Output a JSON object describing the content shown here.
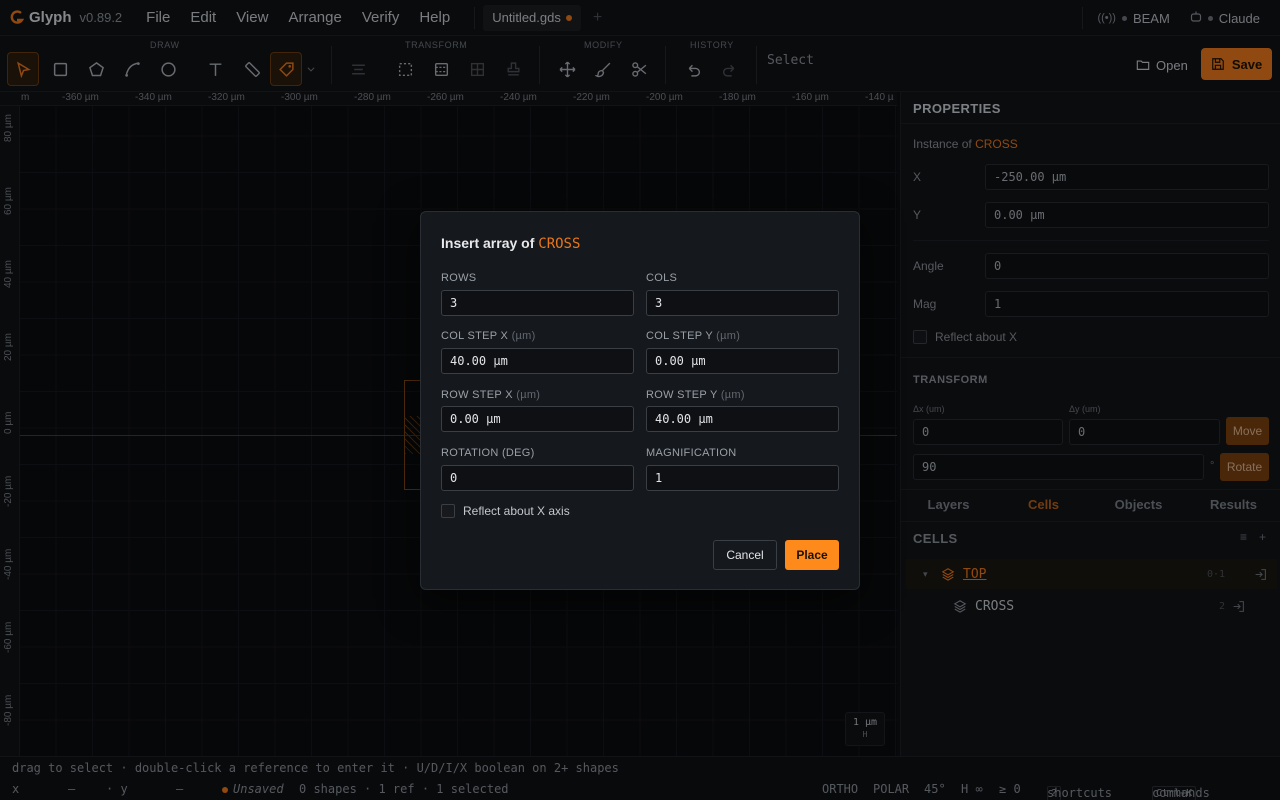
{
  "app": {
    "name": "Glyph",
    "version": "v0.89.2"
  },
  "menu": [
    "File",
    "Edit",
    "View",
    "Arrange",
    "Verify",
    "Help"
  ],
  "document_tab": {
    "label": "Untitled.gds"
  },
  "status_chips": [
    {
      "label": "BEAM",
      "icon": "broadcast-icon"
    },
    {
      "label": "Claude",
      "icon": "robot-icon"
    }
  ],
  "toolbar": {
    "groups": {
      "draw": "DRAW",
      "transform": "TRANSFORM",
      "modify": "MODIFY",
      "history": "HISTORY"
    },
    "mode_label": "Select",
    "open_label": "Open",
    "save_label": "Save"
  },
  "ruler": {
    "top": [
      "m",
      "-360 µm",
      "-340 µm",
      "-320 µm",
      "-300 µm",
      "-280 µm",
      "-260 µm",
      "-240 µm",
      "-220 µm",
      "-200 µm",
      "-180 µm",
      "-160 µm",
      "-140 µ"
    ],
    "left": [
      "80 µm",
      "60 µm",
      "40 µm",
      "20 µm",
      "0 µm",
      "-20 µm",
      "-40 µm",
      "-60 µm",
      "-80 µm"
    ]
  },
  "scale": {
    "value": "1 µm",
    "axis": "H"
  },
  "properties": {
    "title": "PROPERTIES",
    "instance_prefix": "Instance of",
    "instance_cell": "CROSS",
    "x_label": "X",
    "x_value": "-250.00 µm",
    "y_label": "Y",
    "y_value": "0.00 µm",
    "angle_label": "Angle",
    "angle_value": "0",
    "mag_label": "Mag",
    "mag_value": "1",
    "reflect_label": "Reflect about X"
  },
  "transform": {
    "title": "TRANSFORM",
    "dx_label": "Δx (um)",
    "dx_value": "0",
    "dy_label": "Δy (um)",
    "dy_value": "0",
    "move_label": "Move",
    "rotate_value": "90",
    "rotate_unit": "°",
    "rotate_label": "Rotate"
  },
  "panel_tabs": [
    "Layers",
    "Cells",
    "Objects",
    "Results"
  ],
  "cells": {
    "title": "CELLS",
    "items": [
      {
        "name": "TOP",
        "count": "0·1"
      },
      {
        "name": "CROSS",
        "count": "2"
      }
    ]
  },
  "hint": "drag to select · double-click a reference to enter it · U/D/I/X boolean on 2+ shapes",
  "statusbar": {
    "x_label": "x",
    "x_value": "—",
    "y_label": "· y",
    "y_value": "—",
    "unsaved": "Unsaved",
    "summary": "0 shapes · 1 ref · 1 selected",
    "ortho": "ORTHO",
    "polar": "POLAR",
    "angle": "45°",
    "h": "H ∞",
    "ge": "≥ 0",
    "shortcuts_key": "?",
    "shortcuts_label": "shortcuts",
    "commands_key": "Ctrl+K",
    "commands_label": "commands"
  },
  "dialog": {
    "title_prefix": "Insert array of",
    "title_cell": "CROSS",
    "rows_label": "ROWS",
    "rows_value": "3",
    "cols_label": "COLS",
    "cols_value": "3",
    "col_step_x_label": "COL STEP X",
    "col_step_x_unit": "(µm)",
    "col_step_x_value": "40.00 µm",
    "col_step_y_label": "COL STEP Y",
    "col_step_y_unit": "(µm)",
    "col_step_y_value": "0.00 µm",
    "row_step_x_label": "ROW STEP X",
    "row_step_x_unit": "(µm)",
    "row_step_x_value": "0.00 µm",
    "row_step_y_label": "ROW STEP Y",
    "row_step_y_unit": "(µm)",
    "row_step_y_value": "40.00 µm",
    "rotation_label": "ROTATION (DEG)",
    "rotation_value": "0",
    "magnification_label": "MAGNIFICATION",
    "magnification_value": "1",
    "reflect_label": "Reflect about X axis",
    "cancel_label": "Cancel",
    "place_label": "Place"
  },
  "colors": {
    "accent": "#e8771a",
    "background": "#0d0f12",
    "panel": "#121417"
  }
}
